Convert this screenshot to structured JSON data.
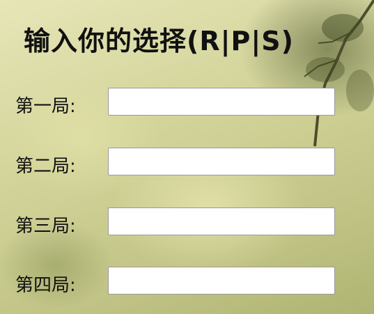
{
  "title": "输入你的选择(R|P|S)",
  "rounds": [
    {
      "label": "第一局:",
      "value": "",
      "placeholder": ""
    },
    {
      "label": "第二局:",
      "value": "",
      "placeholder": ""
    },
    {
      "label": "第三局:",
      "value": "",
      "placeholder": ""
    },
    {
      "label": "第四局:",
      "value": "",
      "placeholder": ""
    }
  ]
}
